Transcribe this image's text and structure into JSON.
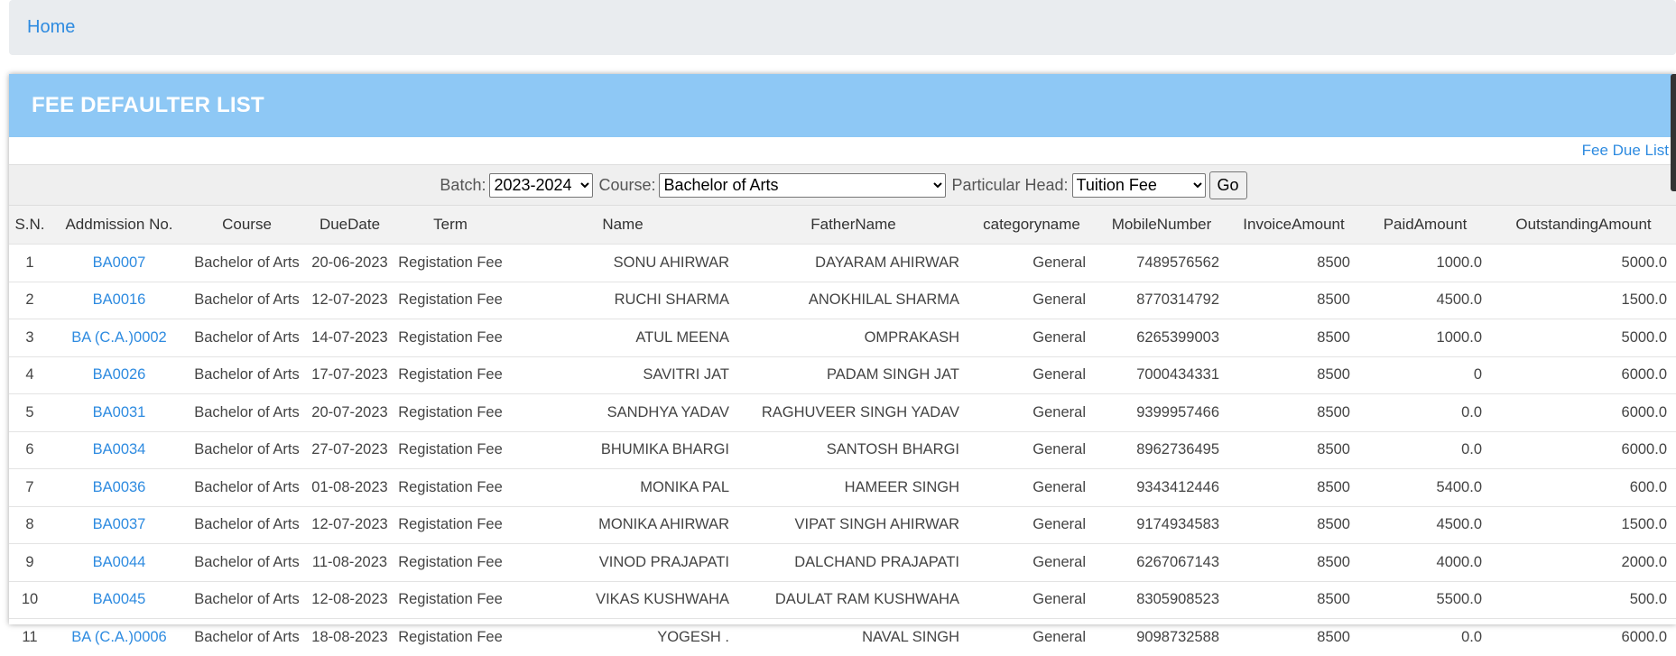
{
  "breadcrumb": {
    "home_label": "Home"
  },
  "panel": {
    "title": "FEE DEFAULTER LIST",
    "fee_due_link": "Fee Due List"
  },
  "filters": {
    "batch_label": "Batch:",
    "batch_value": "2023-2024",
    "course_label": "Course:",
    "course_value": "Bachelor of Arts",
    "head_label": "Particular Head:",
    "head_value": "Tuition Fee",
    "go_label": "Go"
  },
  "table": {
    "headers": [
      "S.N.",
      "Addmission No.",
      "Course",
      "DueDate",
      "Term",
      "Name",
      "FatherName",
      "categoryname",
      "MobileNumber",
      "InvoiceAmount",
      "PaidAmount",
      "OutstandingAmount"
    ],
    "rows": [
      [
        "1",
        "BA0007",
        "Bachelor of Arts",
        "20-06-2023",
        "Registation Fee",
        "SONU AHIRWAR",
        "DAYARAM AHIRWAR",
        "General",
        "7489576562",
        "8500",
        "1000.0",
        "5000.0"
      ],
      [
        "2",
        "BA0016",
        "Bachelor of Arts",
        "12-07-2023",
        "Registation Fee",
        "RUCHI SHARMA",
        "ANOKHILAL SHARMA",
        "General",
        "8770314792",
        "8500",
        "4500.0",
        "1500.0"
      ],
      [
        "3",
        "BA (C.A.)0002",
        "Bachelor of Arts",
        "14-07-2023",
        "Registation Fee",
        "ATUL MEENA",
        "OMPRAKASH",
        "General",
        "6265399003",
        "8500",
        "1000.0",
        "5000.0"
      ],
      [
        "4",
        "BA0026",
        "Bachelor of Arts",
        "17-07-2023",
        "Registation Fee",
        "SAVITRI JAT",
        "PADAM SINGH JAT",
        "General",
        "7000434331",
        "8500",
        "0",
        "6000.0"
      ],
      [
        "5",
        "BA0031",
        "Bachelor of Arts",
        "20-07-2023",
        "Registation Fee",
        "SANDHYA YADAV",
        "RAGHUVEER SINGH YADAV",
        "General",
        "9399957466",
        "8500",
        "0.0",
        "6000.0"
      ],
      [
        "6",
        "BA0034",
        "Bachelor of Arts",
        "27-07-2023",
        "Registation Fee",
        "BHUMIKA BHARGI",
        "SANTOSH BHARGI",
        "General",
        "8962736495",
        "8500",
        "0.0",
        "6000.0"
      ],
      [
        "7",
        "BA0036",
        "Bachelor of Arts",
        "01-08-2023",
        "Registation Fee",
        "MONIKA PAL",
        "HAMEER SINGH",
        "General",
        "9343412446",
        "8500",
        "5400.0",
        "600.0"
      ],
      [
        "8",
        "BA0037",
        "Bachelor of Arts",
        "12-07-2023",
        "Registation Fee",
        "MONIKA AHIRWAR",
        "VIPAT SINGH AHIRWAR",
        "General",
        "9174934583",
        "8500",
        "4500.0",
        "1500.0"
      ],
      [
        "9",
        "BA0044",
        "Bachelor of Arts",
        "11-08-2023",
        "Registation Fee",
        "VINOD PRAJAPATI",
        "DALCHAND PRAJAPATI",
        "General",
        "6267067143",
        "8500",
        "4000.0",
        "2000.0"
      ],
      [
        "10",
        "BA0045",
        "Bachelor of Arts",
        "12-08-2023",
        "Registation Fee",
        "VIKAS KUSHWAHA",
        "DAULAT RAM KUSHWAHA",
        "General",
        "8305908523",
        "8500",
        "5500.0",
        "500.0"
      ],
      [
        "11",
        "BA (C.A.)0006",
        "Bachelor of Arts",
        "18-08-2023",
        "Registation Fee",
        "YOGESH .",
        "NAVAL SINGH",
        "General",
        "9098732588",
        "8500",
        "0.0",
        "6000.0"
      ]
    ]
  },
  "colors": {
    "panel_header": "#8ec8f5",
    "link": "#2e8be0",
    "breadcrumb_bg": "#e9ecef"
  }
}
